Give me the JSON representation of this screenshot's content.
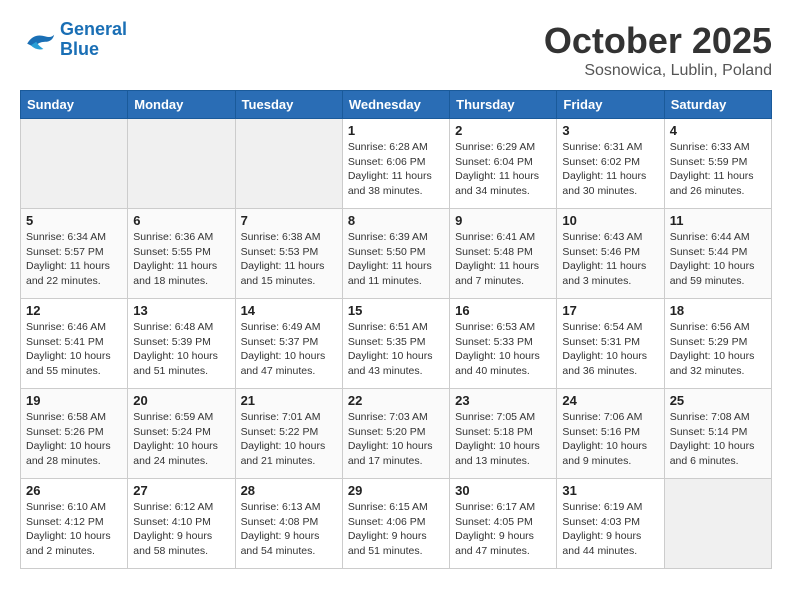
{
  "header": {
    "logo_line1": "General",
    "logo_line2": "Blue",
    "month": "October 2025",
    "location": "Sosnowica, Lublin, Poland"
  },
  "days_of_week": [
    "Sunday",
    "Monday",
    "Tuesday",
    "Wednesday",
    "Thursday",
    "Friday",
    "Saturday"
  ],
  "weeks": [
    [
      {
        "num": "",
        "info": ""
      },
      {
        "num": "",
        "info": ""
      },
      {
        "num": "",
        "info": ""
      },
      {
        "num": "1",
        "info": "Sunrise: 6:28 AM\nSunset: 6:06 PM\nDaylight: 11 hours\nand 38 minutes."
      },
      {
        "num": "2",
        "info": "Sunrise: 6:29 AM\nSunset: 6:04 PM\nDaylight: 11 hours\nand 34 minutes."
      },
      {
        "num": "3",
        "info": "Sunrise: 6:31 AM\nSunset: 6:02 PM\nDaylight: 11 hours\nand 30 minutes."
      },
      {
        "num": "4",
        "info": "Sunrise: 6:33 AM\nSunset: 5:59 PM\nDaylight: 11 hours\nand 26 minutes."
      }
    ],
    [
      {
        "num": "5",
        "info": "Sunrise: 6:34 AM\nSunset: 5:57 PM\nDaylight: 11 hours\nand 22 minutes."
      },
      {
        "num": "6",
        "info": "Sunrise: 6:36 AM\nSunset: 5:55 PM\nDaylight: 11 hours\nand 18 minutes."
      },
      {
        "num": "7",
        "info": "Sunrise: 6:38 AM\nSunset: 5:53 PM\nDaylight: 11 hours\nand 15 minutes."
      },
      {
        "num": "8",
        "info": "Sunrise: 6:39 AM\nSunset: 5:50 PM\nDaylight: 11 hours\nand 11 minutes."
      },
      {
        "num": "9",
        "info": "Sunrise: 6:41 AM\nSunset: 5:48 PM\nDaylight: 11 hours\nand 7 minutes."
      },
      {
        "num": "10",
        "info": "Sunrise: 6:43 AM\nSunset: 5:46 PM\nDaylight: 11 hours\nand 3 minutes."
      },
      {
        "num": "11",
        "info": "Sunrise: 6:44 AM\nSunset: 5:44 PM\nDaylight: 10 hours\nand 59 minutes."
      }
    ],
    [
      {
        "num": "12",
        "info": "Sunrise: 6:46 AM\nSunset: 5:41 PM\nDaylight: 10 hours\nand 55 minutes."
      },
      {
        "num": "13",
        "info": "Sunrise: 6:48 AM\nSunset: 5:39 PM\nDaylight: 10 hours\nand 51 minutes."
      },
      {
        "num": "14",
        "info": "Sunrise: 6:49 AM\nSunset: 5:37 PM\nDaylight: 10 hours\nand 47 minutes."
      },
      {
        "num": "15",
        "info": "Sunrise: 6:51 AM\nSunset: 5:35 PM\nDaylight: 10 hours\nand 43 minutes."
      },
      {
        "num": "16",
        "info": "Sunrise: 6:53 AM\nSunset: 5:33 PM\nDaylight: 10 hours\nand 40 minutes."
      },
      {
        "num": "17",
        "info": "Sunrise: 6:54 AM\nSunset: 5:31 PM\nDaylight: 10 hours\nand 36 minutes."
      },
      {
        "num": "18",
        "info": "Sunrise: 6:56 AM\nSunset: 5:29 PM\nDaylight: 10 hours\nand 32 minutes."
      }
    ],
    [
      {
        "num": "19",
        "info": "Sunrise: 6:58 AM\nSunset: 5:26 PM\nDaylight: 10 hours\nand 28 minutes."
      },
      {
        "num": "20",
        "info": "Sunrise: 6:59 AM\nSunset: 5:24 PM\nDaylight: 10 hours\nand 24 minutes."
      },
      {
        "num": "21",
        "info": "Sunrise: 7:01 AM\nSunset: 5:22 PM\nDaylight: 10 hours\nand 21 minutes."
      },
      {
        "num": "22",
        "info": "Sunrise: 7:03 AM\nSunset: 5:20 PM\nDaylight: 10 hours\nand 17 minutes."
      },
      {
        "num": "23",
        "info": "Sunrise: 7:05 AM\nSunset: 5:18 PM\nDaylight: 10 hours\nand 13 minutes."
      },
      {
        "num": "24",
        "info": "Sunrise: 7:06 AM\nSunset: 5:16 PM\nDaylight: 10 hours\nand 9 minutes."
      },
      {
        "num": "25",
        "info": "Sunrise: 7:08 AM\nSunset: 5:14 PM\nDaylight: 10 hours\nand 6 minutes."
      }
    ],
    [
      {
        "num": "26",
        "info": "Sunrise: 6:10 AM\nSunset: 4:12 PM\nDaylight: 10 hours\nand 2 minutes."
      },
      {
        "num": "27",
        "info": "Sunrise: 6:12 AM\nSunset: 4:10 PM\nDaylight: 9 hours\nand 58 minutes."
      },
      {
        "num": "28",
        "info": "Sunrise: 6:13 AM\nSunset: 4:08 PM\nDaylight: 9 hours\nand 54 minutes."
      },
      {
        "num": "29",
        "info": "Sunrise: 6:15 AM\nSunset: 4:06 PM\nDaylight: 9 hours\nand 51 minutes."
      },
      {
        "num": "30",
        "info": "Sunrise: 6:17 AM\nSunset: 4:05 PM\nDaylight: 9 hours\nand 47 minutes."
      },
      {
        "num": "31",
        "info": "Sunrise: 6:19 AM\nSunset: 4:03 PM\nDaylight: 9 hours\nand 44 minutes."
      },
      {
        "num": "",
        "info": ""
      }
    ]
  ]
}
